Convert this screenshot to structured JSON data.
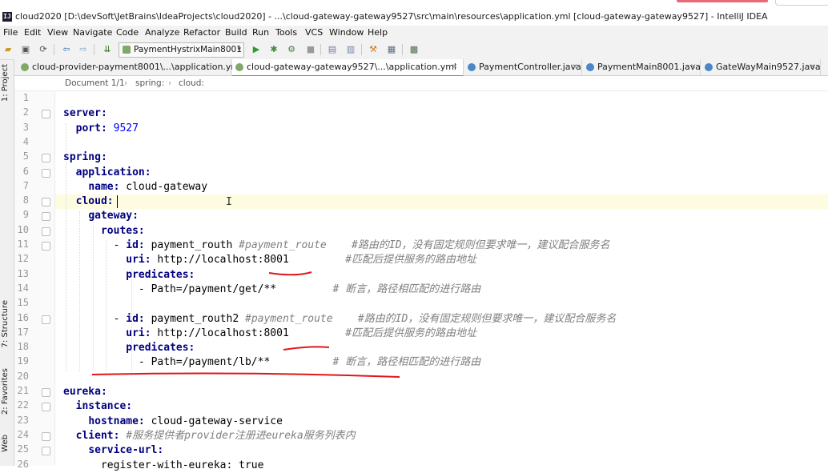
{
  "window": {
    "title": "cloud2020 [D:\\devSoft\\JetBrains\\IdeaProjects\\cloud2020] - ...\\cloud-gateway-gateway9527\\src\\main\\resources\\application.yml [cloud-gateway-gateway9527] - IntelliJ IDEA",
    "app_icon": "IJ"
  },
  "menu": [
    "File",
    "Edit",
    "View",
    "Navigate",
    "Code",
    "Analyze",
    "Refactor",
    "Build",
    "Run",
    "Tools",
    "VCS",
    "Window",
    "Help"
  ],
  "toolbar": {
    "run_config": "PaymentHystrixMain8001",
    "icons": [
      "open-icon",
      "save-icon",
      "sync-icon",
      "back-icon",
      "forward-icon",
      "build-icon",
      "run-icon",
      "debug-icon",
      "coverage-icon",
      "stop-icon",
      "sdk-icon",
      "structure-icon",
      "settings-icon",
      "project-structure-icon"
    ]
  },
  "left_tool_windows": [
    "1: Project",
    "7: Structure",
    "2: Favorites",
    "Web"
  ],
  "tabs": [
    {
      "label": "cloud-provider-payment8001\\...\\application.yml",
      "icon": "yaml-icon",
      "active": false
    },
    {
      "label": "cloud-gateway-gateway9527\\...\\application.yml",
      "icon": "yaml-icon",
      "active": true
    },
    {
      "label": "PaymentController.java",
      "icon": "class-icon",
      "active": false
    },
    {
      "label": "PaymentMain8001.java",
      "icon": "class-icon",
      "active": false
    },
    {
      "label": "GateWayMain9527.java",
      "icon": "class-icon",
      "active": false
    }
  ],
  "breadcrumb": [
    "Document 1/1",
    "spring:",
    "cloud:"
  ],
  "editor": {
    "current_line": 8,
    "lines": [
      {
        "num": "1",
        "parts": []
      },
      {
        "num": "2",
        "parts": [
          {
            "t": "server:",
            "c": "k"
          }
        ]
      },
      {
        "num": "3",
        "parts": [
          {
            "t": "  "
          },
          {
            "t": "port:",
            "c": "k"
          },
          {
            "t": " "
          },
          {
            "t": "9527",
            "c": "n"
          }
        ]
      },
      {
        "num": "4",
        "parts": []
      },
      {
        "num": "5",
        "parts": [
          {
            "t": "spring:",
            "c": "k"
          }
        ]
      },
      {
        "num": "6",
        "parts": [
          {
            "t": "  "
          },
          {
            "t": "application:",
            "c": "k"
          }
        ]
      },
      {
        "num": "7",
        "parts": [
          {
            "t": "    "
          },
          {
            "t": "name:",
            "c": "k"
          },
          {
            "t": " cloud-gateway"
          }
        ]
      },
      {
        "num": "8",
        "parts": [
          {
            "t": "  "
          },
          {
            "t": "cloud:",
            "c": "k"
          }
        ]
      },
      {
        "num": "9",
        "parts": [
          {
            "t": "    "
          },
          {
            "t": "gateway:",
            "c": "k"
          }
        ]
      },
      {
        "num": "10",
        "parts": [
          {
            "t": "      "
          },
          {
            "t": "routes:",
            "c": "k"
          }
        ]
      },
      {
        "num": "11",
        "parts": [
          {
            "t": "        - "
          },
          {
            "t": "id:",
            "c": "k"
          },
          {
            "t": " payment_routh "
          },
          {
            "t": "#payment_route    #路由的ID，没有固定规则但要求唯一，建议配合服务名",
            "c": "c"
          }
        ]
      },
      {
        "num": "12",
        "parts": [
          {
            "t": "          "
          },
          {
            "t": "uri:",
            "c": "k"
          },
          {
            "t": " http://localhost:8001         "
          },
          {
            "t": "#匹配后提供服务的路由地址",
            "c": "c"
          }
        ]
      },
      {
        "num": "13",
        "parts": [
          {
            "t": "          "
          },
          {
            "t": "predicates:",
            "c": "k"
          }
        ]
      },
      {
        "num": "14",
        "parts": [
          {
            "t": "            - Path=/payment/get/**         "
          },
          {
            "t": "# 断言，路径相匹配的进行路由",
            "c": "c"
          }
        ]
      },
      {
        "num": "15",
        "parts": []
      },
      {
        "num": "16",
        "parts": [
          {
            "t": "        - "
          },
          {
            "t": "id:",
            "c": "k"
          },
          {
            "t": " payment_routh2 "
          },
          {
            "t": "#payment_route    #路由的ID，没有固定规则但要求唯一，建议配合服务名",
            "c": "c"
          }
        ]
      },
      {
        "num": "17",
        "parts": [
          {
            "t": "          "
          },
          {
            "t": "uri:",
            "c": "k"
          },
          {
            "t": " http://localhost:8001         "
          },
          {
            "t": "#匹配后提供服务的路由地址",
            "c": "c"
          }
        ]
      },
      {
        "num": "18",
        "parts": [
          {
            "t": "          "
          },
          {
            "t": "predicates:",
            "c": "k"
          }
        ]
      },
      {
        "num": "19",
        "parts": [
          {
            "t": "            - Path=/payment/lb/**          "
          },
          {
            "t": "# 断言，路径相匹配的进行路由",
            "c": "c"
          }
        ]
      },
      {
        "num": "20",
        "parts": []
      },
      {
        "num": "21",
        "parts": [
          {
            "t": "eureka:",
            "c": "k"
          }
        ]
      },
      {
        "num": "22",
        "parts": [
          {
            "t": "  "
          },
          {
            "t": "instance:",
            "c": "k"
          }
        ]
      },
      {
        "num": "23",
        "parts": [
          {
            "t": "    "
          },
          {
            "t": "hostname:",
            "c": "k"
          },
          {
            "t": " cloud-gateway-service"
          }
        ]
      },
      {
        "num": "24",
        "parts": [
          {
            "t": "  "
          },
          {
            "t": "client:",
            "c": "k"
          },
          {
            "t": " "
          },
          {
            "t": "#服务提供者provider注册进eureka服务列表内",
            "c": "c"
          }
        ]
      },
      {
        "num": "25",
        "parts": [
          {
            "t": "    "
          },
          {
            "t": "service-url:",
            "c": "k"
          }
        ]
      },
      {
        "num": "26",
        "parts": [
          {
            "t": "      register-with-eureka: true"
          }
        ]
      }
    ]
  },
  "colors": {
    "annotation": "#e0161b",
    "keyword": "#000080",
    "number": "#0000ff",
    "comment": "#808080",
    "current_line": "#fdfbe0",
    "active_tab_underline": "#4d8ed6"
  }
}
